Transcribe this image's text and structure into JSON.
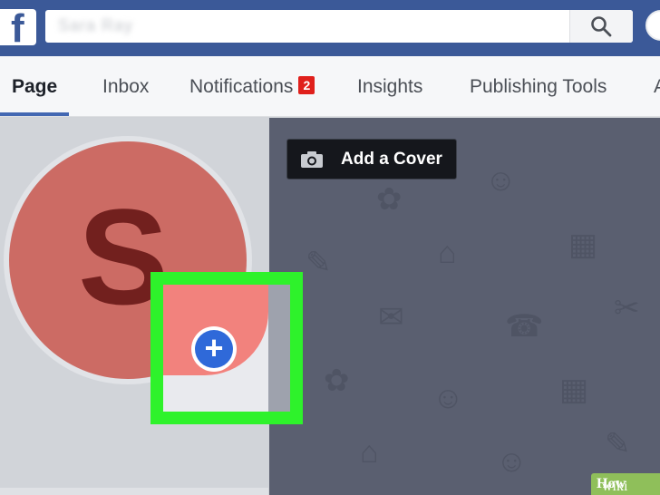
{
  "header": {
    "logo_glyph": "f",
    "search_value": "Sara Ray"
  },
  "tabs": [
    {
      "label": "Page",
      "active": true
    },
    {
      "label": "Inbox",
      "active": false
    },
    {
      "label": "Notifications",
      "active": false,
      "badge": "2"
    },
    {
      "label": "Insights",
      "active": false
    },
    {
      "label": "Publishing Tools",
      "active": false
    },
    {
      "label": "A",
      "active": false
    }
  ],
  "profile": {
    "initial": "S",
    "circle_color": "#cc6b64",
    "plus_symbol": "+"
  },
  "cover": {
    "add_cover_label": "Add a Cover"
  },
  "highlight": {
    "color": "#2ef22b"
  },
  "watermark": {
    "prefix": "wiki",
    "suffix": "How"
  },
  "icons": [
    "facebook-logo-icon",
    "search-icon",
    "camera-icon",
    "plus-icon"
  ]
}
